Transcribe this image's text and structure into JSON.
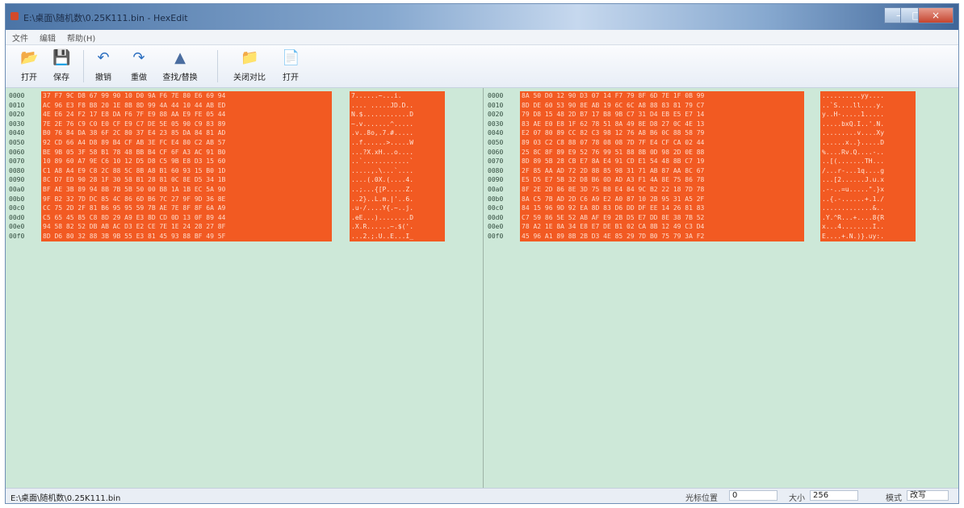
{
  "window": {
    "title": "E:\\桌面\\随机数\\0.25K111.bin - HexEdit",
    "minimize": "–",
    "maximize": "□",
    "close": "×"
  },
  "menu": [
    "文件",
    "编辑",
    "帮助(H)"
  ],
  "toolbar": [
    {
      "label": "打开",
      "icon": "open-file-icon",
      "glyph": "📂"
    },
    {
      "label": "保存",
      "icon": "save-icon",
      "glyph": "💾"
    },
    {
      "label": "撤销",
      "icon": "undo-icon",
      "glyph": "↶"
    },
    {
      "label": "重做",
      "icon": "redo-icon",
      "glyph": "↷"
    },
    {
      "label": "查找/替换",
      "icon": "find-replace-icon",
      "glyph": "▲"
    },
    {
      "label": "关闭对比",
      "icon": "close-compare-icon",
      "glyph": "📁"
    },
    {
      "label": "打开",
      "icon": "open-compare-icon",
      "glyph": "📄"
    }
  ],
  "left_pane": {
    "rows": [
      {
        "addr": "0000",
        "hex": "37 F7 9C D8 67 99 90 10 D0 9A F6 7E 80 E6 69 94",
        "ascii": "7......~...i."
      },
      {
        "addr": "0010",
        "hex": "AC 96 E3 F8 B8 20 1E 8B 8D 99 4A 44 10 44 AB ED",
        "ascii": ".... .....JD.D.."
      },
      {
        "addr": "0020",
        "hex": "4E E6 24 F2 17 E8 DA F6 7F E9 88 AA E9 FE 05 44",
        "ascii": "N.$............D"
      },
      {
        "addr": "0030",
        "hex": "7E 2E 76 C9 C0 E0 CF E9 C7 DE 5E 05 90 C9 83 89",
        "ascii": "~.v.......^....."
      },
      {
        "addr": "0040",
        "hex": "B0 76 84 DA 38 6F 2C 80 37 E4 23 85 DA 84 81 AD",
        "ascii": ".v..8o,.7.#....."
      },
      {
        "addr": "0050",
        "hex": "92 CD 66 A4 D8 89 B4 CF AB 3E FC E4 80 C2 AB 57",
        "ascii": "..f......>.....W"
      },
      {
        "addr": "0060",
        "hex": "BE 9B 05 3F 58 B1 78 48 BB B4 CF 6F A3 AC 91 B0",
        "ascii": "...?X.xH...o...."
      },
      {
        "addr": "0070",
        "hex": "10 89 60 A7 9E C6 10 12 D5 D8 C5 9B E8 D3 15 60",
        "ascii": "..`............`"
      },
      {
        "addr": "0080",
        "hex": "C1 A8 A4 E9 C8 2C 88 5C 8B A8 B1 60 93 15 B0 1D",
        "ascii": ".....,.\\...`...."
      },
      {
        "addr": "0090",
        "hex": "8C D7 ED 90 28 1F 30 58 B1 28 81 0C 8E D5 34 1B",
        "ascii": "....(.0X.(....4."
      },
      {
        "addr": "00a0",
        "hex": "BF AE 3B 89 94 8B 7B 5B 50 00 B8 1A 1B EC 5A 90",
        "ascii": "..;...{[P.....Z."
      },
      {
        "addr": "00b0",
        "hex": "9F B2 32 7D DC 85 4C 86 6D B6 7C 27 9F 9D 36 8E",
        "ascii": "..2}..L.m.|'..6."
      },
      {
        "addr": "00c0",
        "hex": "CC 75 2D 2F 81 B6 95 95 59 7B AE 7E 8F 8F 6A A9",
        "ascii": ".u-/....Y{.~..j."
      },
      {
        "addr": "00d0",
        "hex": "C5 65 45 85 C8 8D 29 A9 E3 8D CD 0D 13 0F 89 44",
        "ascii": ".eE...)........D"
      },
      {
        "addr": "00e0",
        "hex": "94 58 82 52 DB AB AC D3 E2 CE 7E 1E 24 28 27 8F",
        "ascii": ".X.R......~.$('."
      },
      {
        "addr": "00f0",
        "hex": "8D D6 80 32 88 3B 9B 55 E3 81 45 93 88 BF 49 5F",
        "ascii": "...2.;.U..E...I_"
      }
    ]
  },
  "right_pane": {
    "rows": [
      {
        "addr": "0000",
        "hex": "8A 50 D0 12 90 D3 07 14 F7 79 8F 6D 7E 1F 0B 99",
        "ascii": "..........yy...."
      },
      {
        "addr": "0010",
        "hex": "8D DE 60 53 90 8E AB 19 6C 6C A8 88 83 81 79 C7",
        "ascii": "..`S....ll....y."
      },
      {
        "addr": "0020",
        "hex": "79 D8 15 48 2D B7 17 B8 9B C7 31 D4 EB E5 E7 14",
        "ascii": "y..H-.....1....."
      },
      {
        "addr": "0030",
        "hex": "83 AE E0 E8 1F 62 78 51 8A 49 8E D8 27 0C 4E 13",
        "ascii": ".....bxQ.I..'.N."
      },
      {
        "addr": "0040",
        "hex": "E2 07 80 89 CC 82 C3 98 12 76 A8 B6 0C 88 58 79",
        "ascii": ".........v....Xy"
      },
      {
        "addr": "0050",
        "hex": "89 03 C2 C8 88 07 78 08 08 7D 7F E4 CF CA 02 44",
        "ascii": "......x..}.....D"
      },
      {
        "addr": "0060",
        "hex": "25 8C 8F 89 E9 52 76 99 51 88 8B 0D 98 2D 0E 88",
        "ascii": "%....Rv.Q....-.."
      },
      {
        "addr": "0070",
        "hex": "8D 89 5B 28 CB E7 8A E4 91 CD E1 54 48 8B C7 19",
        "ascii": "..[(.......TH..."
      },
      {
        "addr": "0080",
        "hex": "2F 85 AA AD 72 2D 88 85 98 31 71 AB 87 AA 8C 67",
        "ascii": "/...r-...1q....g"
      },
      {
        "addr": "0090",
        "hex": "E5 D5 E7 5B 32 D8 B6 0D AD A3 F1 4A 8E 75 86 78",
        "ascii": "...[2......J.u.x"
      },
      {
        "addr": "00a0",
        "hex": "8F 2E 2D 86 8E 3D 75 B8 E4 84 9C B2 22 18 7D 78",
        "ascii": ".--..=u.....\".}x"
      },
      {
        "addr": "00b0",
        "hex": "8A C5 7B AD 2D C6 A9 E2 A0 87 10 2B 95 31 A5 2F",
        "ascii": "..{.-......+.1./"
      },
      {
        "addr": "00c0",
        "hex": "84 15 96 9D 92 EA 8D 83 D6 DD DF EE 14 26 81 83",
        "ascii": ".............&.."
      },
      {
        "addr": "00d0",
        "hex": "C7 59 86 5E 52 AB AF E9 2B D5 E7 DD 8E 38 7B 52",
        "ascii": ".Y.^R...+....8{R"
      },
      {
        "addr": "00e0",
        "hex": "78 A2 1E 8A 34 E8 E7 DE B1 02 CA 8B 12 49 C3 D4",
        "ascii": "x...4........I.."
      },
      {
        "addr": "00f0",
        "hex": "45 96 A1 89 8B 2B D3 4E 85 29 7D B0 75 79 3A F2",
        "ascii": "E....+.N.)}.uy:."
      }
    ]
  },
  "status": {
    "path": "E:\\桌面\\随机数\\0.25K111.bin",
    "cursor_label": "光标位置",
    "cursor_value": "0",
    "size_label": "大小",
    "size_value": "256",
    "mode_label": "模式",
    "mode_value": "改写"
  }
}
